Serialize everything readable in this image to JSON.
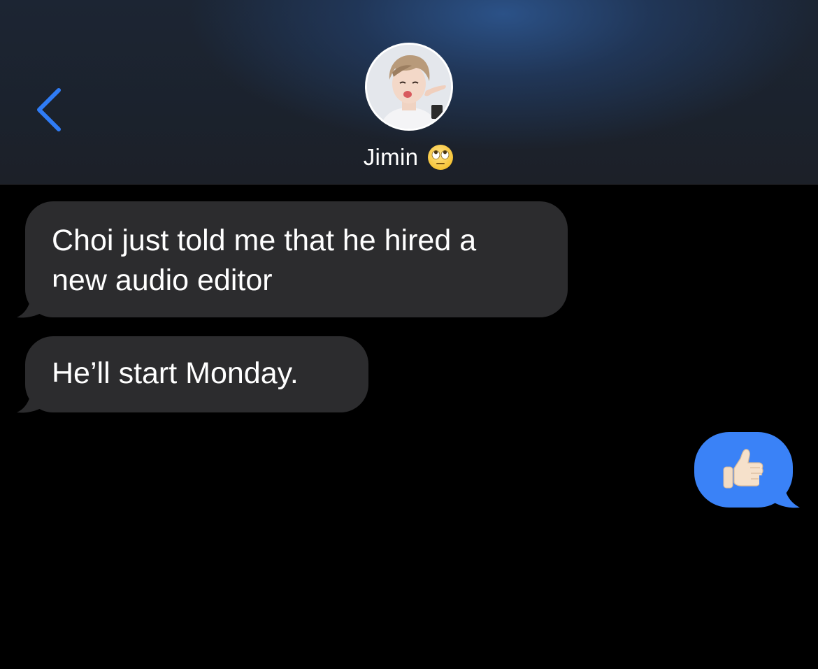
{
  "header": {
    "contact_name": "Jimin",
    "status_emoji": "face-with-rolling-eyes-icon",
    "back_icon": "chevron-left-icon",
    "accent_color": "#2f7cf6"
  },
  "conversation": {
    "messages": [
      {
        "direction": "incoming",
        "text": "Choi just told me that he hired a\nnew audio editor"
      },
      {
        "direction": "incoming",
        "text": "He’ll start Monday."
      },
      {
        "direction": "outgoing",
        "emoji": "thumbs-up-icon",
        "bubble_color": "#3a82f7"
      }
    ],
    "incoming_bubble_color": "#2c2c2e"
  }
}
